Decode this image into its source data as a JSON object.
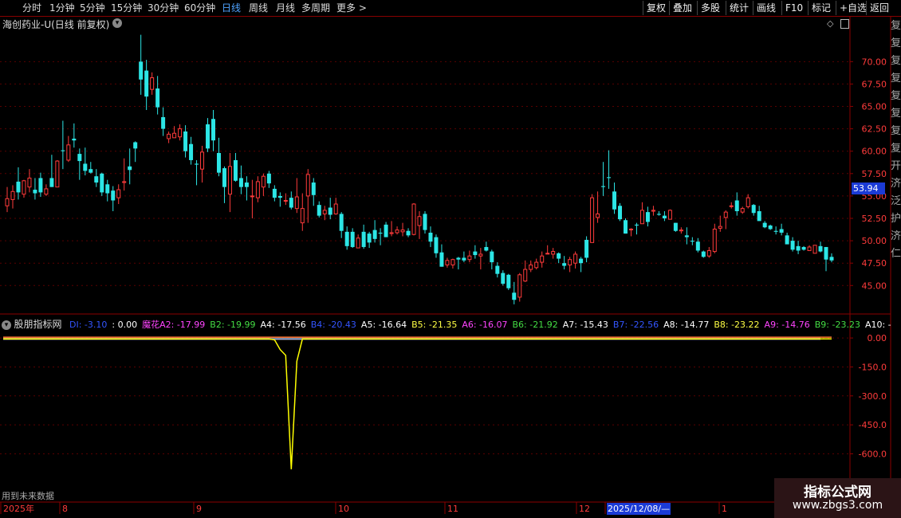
{
  "toolbar": {
    "timeframes": [
      "分时",
      "1分钟",
      "5分钟",
      "15分钟",
      "30分钟",
      "60分钟",
      "日线",
      "周线",
      "月线",
      "多周期",
      "更多 >"
    ],
    "active_timeframe": "日线",
    "buttons": [
      "复权",
      "叠加",
      "多股",
      "统计",
      "画线",
      "F10",
      "标记",
      "+自选",
      "返回"
    ]
  },
  "stock_title": "海创药业-U(日线 前复权)",
  "last_price_label": "53.94",
  "side_chars": [
    "复",
    "复",
    "复",
    "复",
    "复",
    "复",
    "复",
    "复",
    "开",
    "济",
    "泛",
    "护",
    "济",
    "仁"
  ],
  "indicator": {
    "name": "股朋指标网",
    "warning": "用到未来数据",
    "values": [
      {
        "label": "DI: -3.10",
        "color": "#3355ff"
      },
      {
        "label": ": 0.00",
        "color": "#ffffff"
      },
      {
        "label": "魔花A2: -17.99",
        "color": "#ff44ff"
      },
      {
        "label": "B2: -19.99",
        "color": "#44dd44"
      },
      {
        "label": "A4: -17.56",
        "color": "#ffffff"
      },
      {
        "label": "B4: -20.43",
        "color": "#3355ff"
      },
      {
        "label": "A5: -16.64",
        "color": "#ffffff"
      },
      {
        "label": "B5: -21.35",
        "color": "#ffff44"
      },
      {
        "label": "A6: -16.07",
        "color": "#ff44ff"
      },
      {
        "label": "B6: -21.92",
        "color": "#44dd44"
      },
      {
        "label": "A7: -15.43",
        "color": "#ffffff"
      },
      {
        "label": "B7: -22.56",
        "color": "#3355ff"
      },
      {
        "label": "A8: -14.77",
        "color": "#ffffff"
      },
      {
        "label": "B8: -23.22",
        "color": "#ffff44"
      },
      {
        "label": "A9: -14.76",
        "color": "#ff44ff"
      },
      {
        "label": "B9: -23.23",
        "color": "#44dd44"
      },
      {
        "label": "A10: -",
        "color": "#ffffff"
      }
    ]
  },
  "date_axis": {
    "labels": [
      "2025年",
      "8",
      "9",
      "10",
      "11",
      "12",
      "2025/12/08/—",
      "1"
    ],
    "highlighted": "2025/12/08/—"
  },
  "watermark": {
    "line1": "指标公式网",
    "line2": "www.zbgs3.com"
  },
  "colors": {
    "up": "#ff3b3b",
    "down": "#2ce6e6",
    "axis": "#8b0000",
    "grid": "#5a0000",
    "indicator_line": "#ffff00"
  },
  "chart_data": {
    "type": "candlestick",
    "price_axis": {
      "ticks": [
        "70.00",
        "67.50",
        "65.00",
        "62.50",
        "60.00",
        "57.50",
        "55.00",
        "52.50",
        "50.00",
        "47.50",
        "45.00"
      ],
      "range": [
        42.0,
        73.5
      ]
    },
    "indicator_axis": {
      "ticks": [
        "0.00",
        "-150.0",
        "-300.0",
        "-450.0",
        "-600.0"
      ],
      "range": [
        -850,
        50
      ]
    },
    "candles": [
      [
        53.9,
        56.0,
        53.2,
        54.7
      ],
      [
        54.6,
        56.2,
        53.6,
        55.5
      ],
      [
        56.6,
        58.2,
        54.6,
        55.4
      ],
      [
        55.2,
        56.8,
        54.8,
        56.7
      ],
      [
        56.0,
        58.0,
        55.4,
        57.0
      ],
      [
        55.7,
        57.0,
        54.6,
        55.3
      ],
      [
        57.0,
        57.6,
        54.9,
        55.4
      ],
      [
        55.2,
        56.3,
        55.0,
        55.8
      ],
      [
        57.0,
        59.6,
        56.0,
        56.0
      ],
      [
        56.0,
        59.0,
        56.0,
        58.9
      ],
      [
        60.1,
        63.4,
        58.0,
        60.0
      ],
      [
        59.0,
        61.7,
        58.8,
        60.7
      ],
      [
        61.4,
        63.1,
        60.4,
        61.2
      ],
      [
        59.7,
        60.3,
        56.8,
        58.9
      ],
      [
        58.6,
        60.4,
        57.3,
        57.8
      ],
      [
        58.0,
        58.8,
        57.5,
        57.6
      ],
      [
        57.2,
        58.0,
        56.0,
        56.5
      ],
      [
        57.5,
        57.6,
        55.0,
        55.4
      ],
      [
        56.3,
        56.8,
        54.4,
        55.3
      ],
      [
        55.6,
        56.1,
        53.3,
        54.5
      ],
      [
        54.8,
        56.3,
        54.1,
        55.7
      ],
      [
        56.5,
        59.2,
        55.6,
        56.6
      ],
      [
        58.3,
        60.3,
        56.3,
        57.9
      ],
      [
        61.0,
        61.1,
        58.8,
        60.3
      ],
      [
        70.0,
        73.0,
        66.3,
        68.0
      ],
      [
        69.0,
        70.2,
        64.6,
        66.1
      ],
      [
        66.9,
        68.8,
        66.3,
        68.2
      ],
      [
        67.0,
        68.4,
        64.1,
        64.9
      ],
      [
        63.8,
        64.9,
        61.7,
        62.5
      ],
      [
        61.4,
        62.2,
        60.9,
        61.9
      ],
      [
        61.5,
        62.8,
        61.6,
        62.0
      ],
      [
        61.6,
        63.0,
        61.2,
        62.5
      ],
      [
        62.2,
        62.9,
        59.3,
        60.0
      ],
      [
        60.8,
        61.6,
        58.5,
        59.0
      ],
      [
        58.6,
        59.0,
        56.2,
        58.5
      ],
      [
        58.0,
        60.6,
        56.5,
        59.9
      ],
      [
        63.0,
        63.7,
        59.9,
        60.3
      ],
      [
        63.6,
        64.6,
        60.0,
        61.2
      ],
      [
        59.8,
        61.5,
        57.2,
        57.6
      ],
      [
        58.1,
        58.3,
        54.2,
        56.0
      ],
      [
        55.2,
        59.8,
        53.2,
        58.3
      ],
      [
        59.0,
        59.8,
        56.6,
        56.7
      ],
      [
        57.0,
        58.4,
        55.2,
        56.0
      ],
      [
        56.5,
        57.2,
        54.5,
        56.0
      ],
      [
        55.0,
        56.8,
        52.5,
        55.0
      ],
      [
        54.8,
        57.2,
        54.3,
        56.6
      ],
      [
        56.0,
        57.5,
        55.0,
        57.2
      ],
      [
        57.5,
        57.8,
        55.9,
        56.4
      ],
      [
        55.8,
        56.2,
        54.4,
        54.8
      ],
      [
        55.0,
        55.4,
        53.8,
        54.8
      ],
      [
        54.5,
        55.3,
        54.0,
        54.5
      ],
      [
        54.8,
        55.5,
        53.5,
        53.7
      ],
      [
        53.6,
        57.0,
        53.1,
        54.9
      ],
      [
        52.0,
        55.3,
        51.1,
        53.6
      ],
      [
        55.0,
        58.0,
        52.0,
        57.4
      ],
      [
        56.5,
        57.0,
        53.9,
        55.1
      ],
      [
        54.0,
        54.4,
        52.6,
        52.8
      ],
      [
        53.0,
        53.9,
        52.3,
        53.4
      ],
      [
        53.7,
        54.8,
        52.4,
        52.9
      ],
      [
        53.0,
        54.8,
        52.9,
        54.1
      ],
      [
        53.0,
        53.2,
        50.3,
        51.1
      ],
      [
        51.0,
        51.6,
        49.0,
        49.4
      ],
      [
        51.0,
        51.4,
        49.2,
        49.3
      ],
      [
        49.2,
        50.7,
        49.2,
        50.3
      ],
      [
        51.0,
        51.8,
        49.1,
        49.3
      ],
      [
        50.8,
        51.0,
        49.2,
        49.8
      ],
      [
        51.2,
        52.3,
        49.8,
        50.2
      ],
      [
        50.9,
        51.4,
        49.5,
        50.8
      ],
      [
        51.8,
        52.1,
        50.4,
        50.4
      ],
      [
        50.8,
        52.2,
        50.5,
        50.9
      ],
      [
        50.9,
        51.6,
        50.7,
        51.2
      ],
      [
        51.0,
        52.0,
        50.5,
        51.2
      ],
      [
        51.1,
        51.4,
        50.4,
        50.6
      ],
      [
        50.7,
        54.2,
        50.6,
        54.1
      ],
      [
        51.7,
        53.3,
        50.2,
        52.7
      ],
      [
        53.0,
        53.3,
        50.8,
        51.2
      ],
      [
        50.9,
        51.6,
        49.3,
        49.9
      ],
      [
        50.4,
        50.7,
        48.1,
        48.6
      ],
      [
        48.7,
        49.6,
        47.1,
        47.1
      ],
      [
        47.3,
        48.1,
        47.0,
        47.8
      ],
      [
        47.3,
        48.0,
        46.9,
        47.9
      ],
      [
        48.1,
        48.2,
        46.8,
        47.9
      ],
      [
        48.1,
        48.8,
        47.6,
        47.8
      ],
      [
        47.9,
        48.9,
        47.6,
        48.3
      ],
      [
        48.8,
        49.5,
        48.0,
        48.4
      ],
      [
        48.3,
        49.2,
        46.8,
        48.5
      ],
      [
        49.3,
        49.9,
        48.8,
        48.9
      ],
      [
        48.8,
        49.0,
        46.8,
        47.6
      ],
      [
        47.2,
        47.6,
        45.9,
        46.3
      ],
      [
        46.4,
        46.7,
        45.0,
        45.2
      ],
      [
        46.2,
        46.3,
        44.5,
        44.7
      ],
      [
        44.2,
        45.4,
        42.9,
        43.4
      ],
      [
        43.7,
        46.4,
        43.2,
        46.2
      ],
      [
        45.5,
        47.8,
        45.4,
        46.8
      ],
      [
        46.8,
        47.8,
        46.5,
        47.3
      ],
      [
        47.0,
        48.0,
        46.8,
        47.6
      ],
      [
        47.6,
        48.8,
        47.0,
        48.3
      ],
      [
        48.6,
        49.5,
        48.5,
        48.6
      ],
      [
        48.5,
        49.2,
        48.0,
        48.8
      ],
      [
        48.6,
        48.7,
        47.5,
        48.0
      ],
      [
        47.5,
        48.3,
        46.8,
        47.2
      ],
      [
        47.3,
        48.2,
        46.5,
        47.9
      ],
      [
        47.5,
        48.8,
        46.9,
        48.5
      ],
      [
        48.0,
        48.2,
        46.5,
        47.5
      ],
      [
        50.1,
        50.5,
        47.6,
        48.1
      ],
      [
        49.8,
        55.2,
        49.9,
        54.8
      ],
      [
        52.6,
        55.5,
        52.0,
        53.0
      ],
      [
        56.1,
        58.8,
        55.0,
        56.0
      ],
      [
        57.1,
        60.1,
        55.8,
        57.0
      ],
      [
        55.5,
        56.5,
        53.0,
        53.5
      ],
      [
        53.9,
        54.2,
        52.2,
        52.4
      ],
      [
        52.3,
        52.5,
        50.8,
        50.8
      ],
      [
        51.3,
        51.4,
        50.5,
        51.3
      ],
      [
        51.8,
        52.0,
        50.7,
        51.7
      ],
      [
        51.9,
        54.3,
        52.1,
        53.4
      ],
      [
        53.2,
        53.8,
        51.6,
        52.1
      ],
      [
        53.3,
        53.9,
        52.8,
        53.4
      ],
      [
        53.0,
        53.3,
        52.8,
        52.9
      ],
      [
        52.8,
        53.3,
        52.2,
        52.5
      ],
      [
        52.4,
        53.5,
        52.4,
        53.4
      ],
      [
        52.0,
        52.0,
        51.0,
        51.1
      ],
      [
        51.1,
        51.5,
        50.8,
        51.2
      ],
      [
        50.6,
        51.5,
        49.6,
        50.4
      ],
      [
        50.0,
        50.4,
        49.5,
        49.9
      ],
      [
        49.9,
        50.3,
        48.7,
        48.9
      ],
      [
        48.8,
        48.9,
        48.1,
        48.2
      ],
      [
        48.3,
        49.3,
        48.1,
        48.9
      ],
      [
        48.8,
        51.9,
        48.6,
        51.3
      ],
      [
        51.4,
        52.8,
        51.0,
        51.6
      ],
      [
        52.6,
        53.4,
        51.3,
        53.2
      ],
      [
        53.9,
        54.3,
        53.6,
        53.9
      ],
      [
        54.5,
        55.4,
        52.8,
        53.3
      ],
      [
        53.2,
        53.8,
        53.0,
        53.6
      ],
      [
        53.8,
        55.2,
        53.6,
        54.8
      ],
      [
        54.0,
        54.1,
        52.8,
        53.1
      ],
      [
        53.3,
        53.9,
        52.4,
        52.2
      ],
      [
        52.0,
        52.2,
        51.4,
        51.5
      ],
      [
        51.7,
        51.8,
        51.2,
        51.3
      ],
      [
        51.1,
        51.6,
        50.7,
        51.0
      ],
      [
        51.3,
        51.9,
        50.6,
        50.9
      ],
      [
        50.6,
        50.9,
        49.7,
        49.6
      ],
      [
        50.0,
        50.4,
        48.8,
        49.0
      ],
      [
        49.4,
        50.0,
        48.5,
        48.9
      ],
      [
        49.3,
        49.4,
        48.9,
        49.0
      ],
      [
        48.9,
        49.5,
        49.1,
        49.3
      ],
      [
        48.6,
        49.5,
        48.7,
        49.5
      ],
      [
        49.4,
        49.9,
        48.7,
        48.8
      ],
      [
        49.3,
        49.3,
        46.6,
        47.9
      ],
      [
        48.2,
        48.6,
        47.6,
        47.8
      ]
    ],
    "indicator_series": [
      {
        "name": "A/B bundle top",
        "values": [
          0,
          0,
          0,
          0,
          0,
          0,
          0,
          0,
          0,
          0,
          0,
          0,
          0,
          0,
          0,
          0,
          0,
          0,
          0,
          0,
          0,
          0,
          0,
          0,
          0,
          0,
          0,
          0,
          0,
          0,
          0,
          0,
          0,
          0,
          0,
          0,
          0,
          0,
          0,
          0,
          0,
          0,
          0,
          0,
          0,
          0,
          0,
          0,
          0,
          0,
          0,
          0,
          0,
          0,
          0,
          0,
          0,
          0,
          0,
          0,
          0,
          0,
          0,
          0,
          0,
          0,
          0,
          0,
          0,
          0,
          0,
          0,
          0,
          0,
          0,
          0,
          0,
          0,
          0,
          0,
          0,
          0,
          0,
          0,
          0,
          0,
          0,
          0,
          0,
          0,
          0,
          0,
          0,
          0,
          0,
          0,
          0,
          0,
          0,
          0,
          0,
          0,
          0,
          0,
          0,
          0,
          0,
          0,
          0,
          0,
          0,
          0,
          0,
          0,
          0,
          0,
          0,
          0,
          0,
          0,
          0,
          0,
          0,
          0,
          0,
          0,
          0,
          0,
          0,
          0,
          0,
          0,
          0,
          0,
          0,
          0,
          0,
          0,
          0,
          0,
          0,
          0,
          0,
          0,
          0,
          0,
          0,
          0,
          0,
          0,
          0,
          0,
          0,
          0,
          0,
          0,
          0,
          0,
          0,
          0,
          0,
          0,
          0,
          0,
          0,
          0,
          0,
          0,
          0,
          0,
          0
        ]
      },
      {
        "name": "DI",
        "values": [
          -5,
          -5,
          -5,
          -5,
          -5,
          -5,
          -5,
          -5,
          -5,
          -5,
          -5,
          -5,
          -5,
          -5,
          -5,
          -5,
          -5,
          -5,
          -5,
          -5,
          -5,
          -5,
          -5,
          -5,
          -5,
          -5,
          -5,
          -5,
          -5,
          -5,
          -5,
          -5,
          -5,
          -5,
          -5,
          -5,
          -5,
          -5,
          -5,
          -5,
          -5,
          -5,
          -5,
          -5,
          -5,
          -5,
          -5,
          -5,
          -10,
          -60,
          -90,
          -680,
          -120,
          -5,
          -5,
          -5,
          -5,
          -5,
          -5,
          -5,
          -5,
          -5,
          -5,
          -5,
          -5,
          -5,
          -5,
          -5,
          -5,
          -5,
          -5,
          -5,
          -5,
          -5,
          -5,
          -5,
          -5,
          -5,
          -5,
          -5,
          -5,
          -5,
          -5,
          -5,
          -5,
          -5,
          -5,
          -5,
          -5,
          -5,
          -5,
          -5,
          -5,
          -5,
          -5,
          -5,
          -5,
          -5,
          -5,
          -5,
          -5,
          -5,
          -5,
          -5,
          -5,
          -5,
          -5,
          -5,
          -5,
          -5,
          -5,
          -5,
          -5,
          -5,
          -5,
          -5,
          -5,
          -5,
          -5,
          -5,
          -5,
          -5,
          -5,
          -5,
          -5,
          -5,
          -5,
          -5,
          -5,
          -5,
          -5,
          -5,
          -5,
          -5,
          -5,
          -5,
          -5,
          -5,
          -5,
          -5,
          -5,
          -5,
          -5,
          -5,
          -5,
          -5,
          -5,
          -5,
          -5,
          -5,
          -5,
          -5,
          -5,
          -5,
          -5,
          -5,
          -5,
          -5,
          -5,
          -5,
          -5,
          -5,
          -5,
          -5,
          -5,
          -5,
          -5,
          -5,
          -5,
          -5,
          -5,
          -5,
          -5,
          -20,
          -25
        ]
      }
    ]
  }
}
